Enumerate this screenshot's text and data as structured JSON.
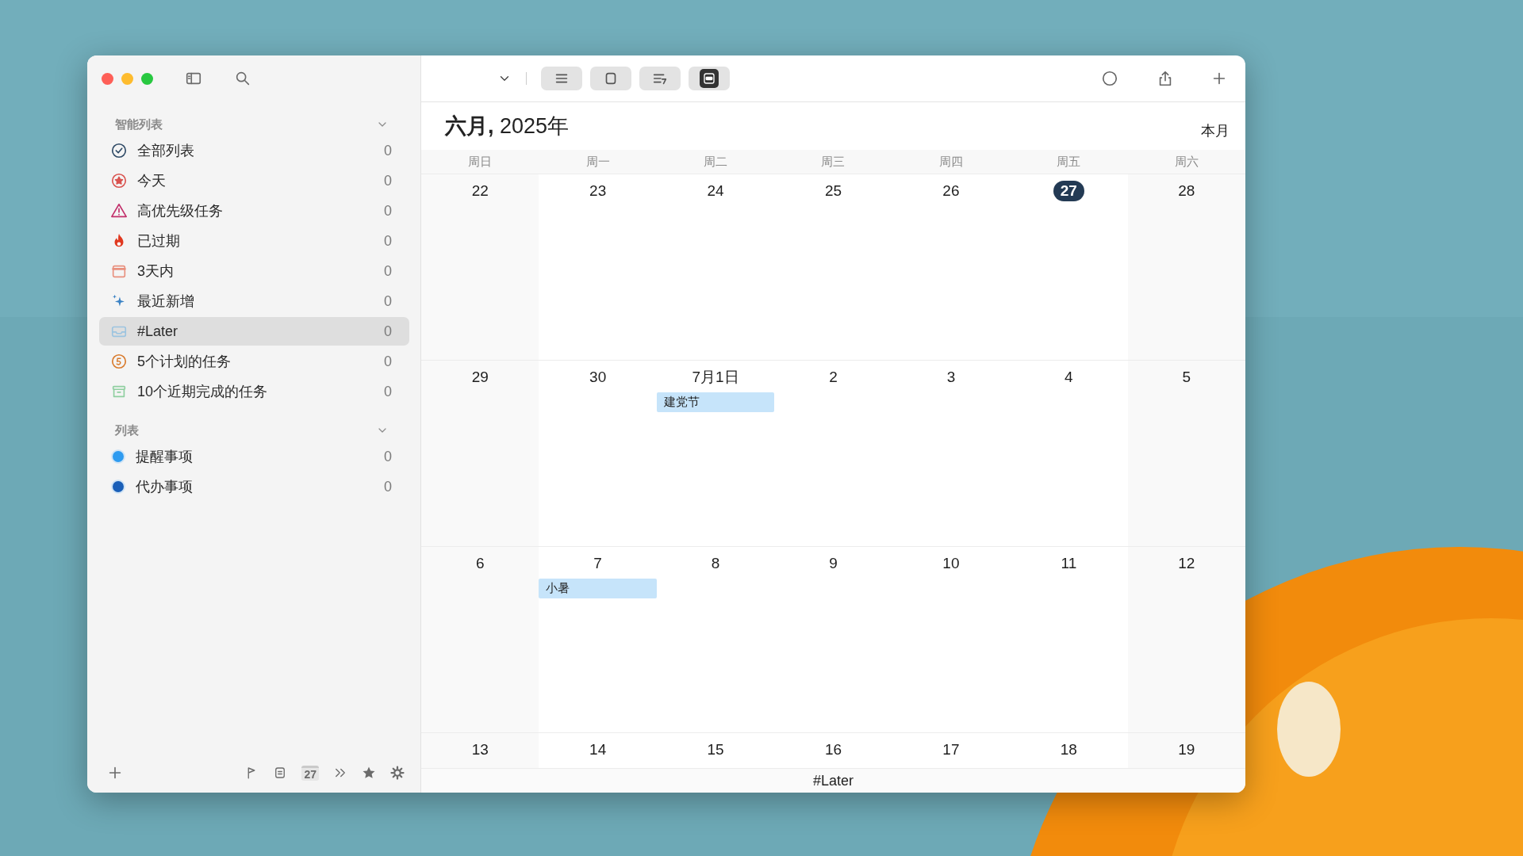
{
  "sidebar": {
    "sections": [
      {
        "title": "智能列表",
        "items": [
          {
            "label": "全部列表",
            "count": "0",
            "selected": false
          },
          {
            "label": "今天",
            "count": "0",
            "selected": false
          },
          {
            "label": "高优先级任务",
            "count": "0",
            "selected": false
          },
          {
            "label": "已过期",
            "count": "0",
            "selected": false
          },
          {
            "label": "3天内",
            "count": "0",
            "selected": false
          },
          {
            "label": "最近新增",
            "count": "0",
            "selected": false
          },
          {
            "label": "#Later",
            "count": "0",
            "selected": true
          },
          {
            "label": "5个计划的任务",
            "count": "0",
            "selected": false
          },
          {
            "label": "10个近期完成的任务",
            "count": "0",
            "selected": false
          }
        ]
      },
      {
        "title": "列表",
        "items": [
          {
            "label": "提醒事项",
            "count": "0",
            "selected": false,
            "color": "#2e9bf0"
          },
          {
            "label": "代办事项",
            "count": "0",
            "selected": false,
            "color": "#1a5fb8"
          }
        ]
      }
    ],
    "footer": {
      "calendar_badge": "27"
    }
  },
  "toolbar": {
    "views": [
      {
        "selected": false
      },
      {
        "selected": false
      },
      {
        "selected": false
      },
      {
        "selected": true
      }
    ]
  },
  "calendar": {
    "title": "**六月,** 2025年",
    "this_month": "本月",
    "weekdays": [
      "周日",
      "周一",
      "周二",
      "周三",
      "周四",
      "周五",
      "周六"
    ],
    "weeks": [
      {
        "days": [
          {
            "label": "22",
            "today": false
          },
          {
            "label": "23",
            "today": false
          },
          {
            "label": "24",
            "today": false
          },
          {
            "label": "25",
            "today": false
          },
          {
            "label": "26",
            "today": false
          },
          {
            "label": "27",
            "today": true
          },
          {
            "label": "28",
            "today": false
          }
        ]
      },
      {
        "days": [
          {
            "label": "29",
            "today": false
          },
          {
            "label": "30",
            "today": false
          },
          {
            "label": "7月1日",
            "today": false,
            "events": [
              "建党节"
            ]
          },
          {
            "label": "2",
            "today": false
          },
          {
            "label": "3",
            "today": false
          },
          {
            "label": "4",
            "today": false
          },
          {
            "label": "5",
            "today": false
          }
        ]
      },
      {
        "days": [
          {
            "label": "6",
            "today": false
          },
          {
            "label": "7",
            "today": false,
            "events": [
              "小暑"
            ]
          },
          {
            "label": "8",
            "today": false
          },
          {
            "label": "9",
            "today": false
          },
          {
            "label": "10",
            "today": false
          },
          {
            "label": "11",
            "today": false
          },
          {
            "label": "12",
            "today": false
          }
        ]
      },
      {
        "days": [
          {
            "label": "13",
            "today": false
          },
          {
            "label": "14",
            "today": false
          },
          {
            "label": "15",
            "today": false
          },
          {
            "label": "16",
            "today": false
          },
          {
            "label": "17",
            "today": false
          },
          {
            "label": "18",
            "today": false
          },
          {
            "label": "19",
            "today": false
          }
        ]
      }
    ],
    "footer": "#Later"
  }
}
